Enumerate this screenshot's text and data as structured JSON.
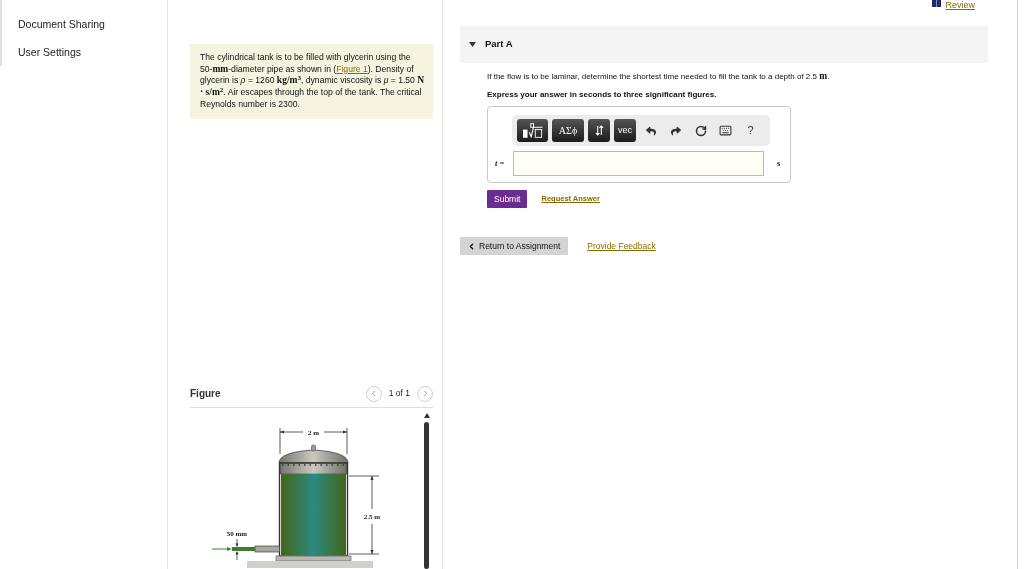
{
  "sidebar": {
    "items": [
      {
        "label": "Document Sharing"
      },
      {
        "label": "User Settings"
      }
    ]
  },
  "review_link": "Review",
  "problem": {
    "segments": [
      {
        "kind": "text",
        "text": "The cylindrical tank is to be filled with glycerin using the 50-"
      },
      {
        "kind": "math",
        "text": "mm"
      },
      {
        "kind": "text",
        "text": "-diameter pipe as shown in ("
      },
      {
        "kind": "link",
        "text": "Figure 1"
      },
      {
        "kind": "text",
        "text": "). Density of glycerin is *ρ* = 1260 "
      },
      {
        "kind": "math",
        "text": "kg/m$^{3}$"
      },
      {
        "kind": "text",
        "text": ", dynamic viscosity is *μ* = 1.50 "
      },
      {
        "kind": "math",
        "text": "N · s/m$^{2}$"
      },
      {
        "kind": "text",
        "text": ". Air escapes through the top of the tank. The critical Reynolds number is 2300."
      }
    ]
  },
  "figure": {
    "title": "Figure",
    "pager": "1 of 1",
    "width_label": "2 m",
    "depth_label": "2.5 m",
    "pipe_label": "50 mm"
  },
  "part": {
    "title": "Part A",
    "expanded": true,
    "question": [
      {
        "kind": "text",
        "text": "If the flow is to be laminar, determine the shortest time needed to fill the tank to a depth of 2.5 "
      },
      {
        "kind": "math",
        "text": "m"
      },
      {
        "kind": "text",
        "text": "."
      }
    ],
    "instruction": "Express your answer in seconds to three significant figures.",
    "toolbar": [
      {
        "kind": "template"
      },
      {
        "kind": "greek",
        "label": "ΑΣϕ"
      },
      {
        "kind": "arrows"
      },
      {
        "kind": "vector",
        "label": "vec"
      },
      {
        "kind": "undo"
      },
      {
        "kind": "redo"
      },
      {
        "kind": "reset"
      },
      {
        "kind": "keyboard"
      },
      {
        "kind": "help",
        "label": "?"
      }
    ],
    "variable": "*t* =",
    "unit": "s",
    "submit": "Submit",
    "request_answer": "Request Answer"
  },
  "footer": {
    "return": "Return to Assignment",
    "feedback": "Provide Feedback"
  }
}
